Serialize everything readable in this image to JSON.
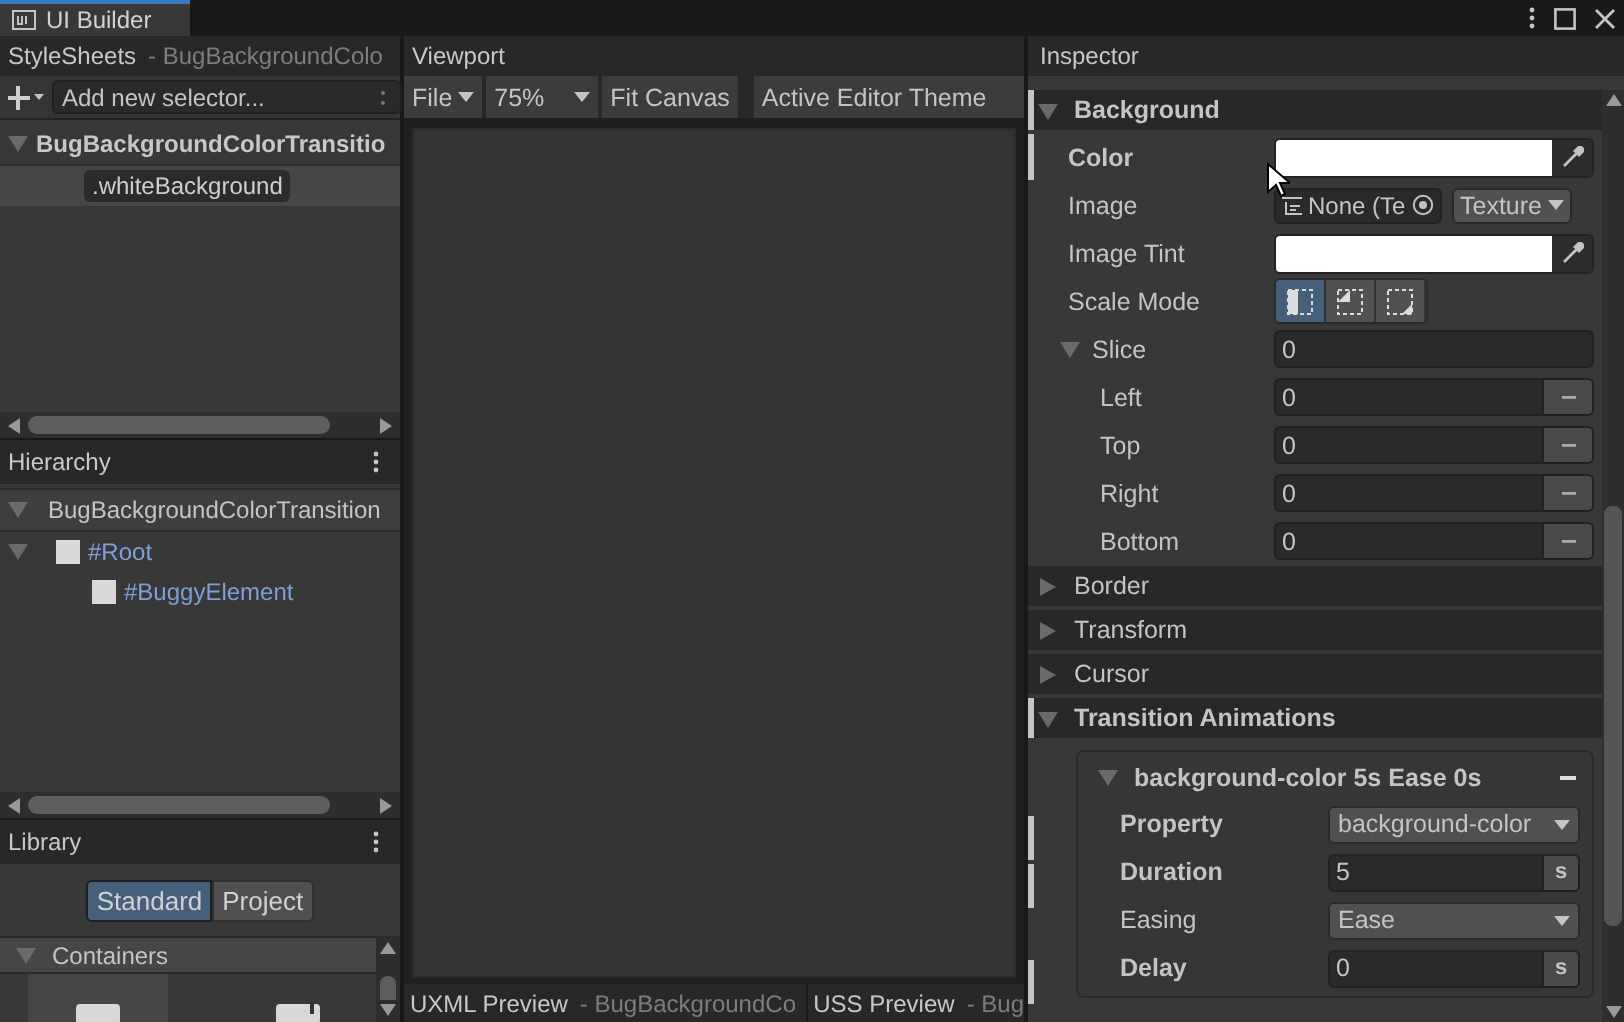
{
  "window_tab": {
    "title": "UI Builder"
  },
  "stylesheets": {
    "title": "StyleSheets",
    "subtitle": "- BugBackgroundColo",
    "selector_placeholder": "Add new selector...",
    "tree": [
      {
        "label": "BugBackgroundColorTransitio",
        "expanded": true,
        "children": [
          {
            "label": ".whiteBackground",
            "selected": true
          }
        ]
      }
    ]
  },
  "hierarchy": {
    "title": "Hierarchy",
    "tree": [
      {
        "label": "BugBackgroundColorTransition",
        "expanded": true,
        "children": [
          {
            "label": "#Root",
            "expanded": true,
            "children": [
              {
                "label": "#BuggyElement"
              }
            ]
          }
        ]
      }
    ]
  },
  "library": {
    "title": "Library",
    "tabs": [
      {
        "label": "Standard",
        "selected": true
      },
      {
        "label": "Project",
        "selected": false
      }
    ],
    "section": {
      "label": "Containers",
      "expanded": true
    }
  },
  "viewport": {
    "title": "Viewport",
    "toolbar": [
      {
        "kind": "menu",
        "label": "File"
      },
      {
        "kind": "dropdown",
        "label": "75%"
      },
      {
        "kind": "button",
        "label": "Fit Canvas"
      },
      {
        "kind": "button",
        "label": "Active Editor Theme"
      }
    ]
  },
  "previews": [
    {
      "title": "UXML Preview",
      "subtitle": "- BugBackgroundCo"
    },
    {
      "title": "USS Preview",
      "subtitle": "- Bug"
    }
  ],
  "inspector": {
    "title": "Inspector",
    "sections": [
      {
        "label": "Background",
        "expanded": true,
        "overridden": true,
        "rows": [
          {
            "kind": "color",
            "label": "Color",
            "overridden": true,
            "color": "#ffffff"
          },
          {
            "kind": "object",
            "label": "Image",
            "overridden": false,
            "value": "None (Te",
            "type": "Texture"
          },
          {
            "kind": "color",
            "label": "Image Tint",
            "overridden": false,
            "color": "#ffffff"
          },
          {
            "kind": "segments",
            "label": "Scale Mode",
            "overridden": false,
            "options": [
              {
                "selected": true
              },
              {
                "selected": false
              },
              {
                "selected": false
              }
            ]
          },
          {
            "kind": "foldout",
            "label": "Slice",
            "overridden": false,
            "expanded": true,
            "value": "0",
            "children": [
              {
                "label": "Left",
                "value": "0"
              },
              {
                "label": "Top",
                "value": "0"
              },
              {
                "label": "Right",
                "value": "0"
              },
              {
                "label": "Bottom",
                "value": "0"
              }
            ]
          }
        ]
      },
      {
        "label": "Border",
        "expanded": false,
        "overridden": false
      },
      {
        "label": "Transform",
        "expanded": false,
        "overridden": false
      },
      {
        "label": "Cursor",
        "expanded": false,
        "overridden": false
      },
      {
        "label": "Transition Animations",
        "expanded": true,
        "overridden": true,
        "transitions": [
          {
            "title": "background-color 5s Ease 0s",
            "expanded": true,
            "fields": [
              {
                "kind": "dropdown",
                "label": "Property",
                "overridden": true,
                "value": "background-color"
              },
              {
                "kind": "number",
                "label": "Duration",
                "overridden": true,
                "value": "5",
                "unit": "s"
              },
              {
                "kind": "dropdown",
                "label": "Easing",
                "overridden": false,
                "value": "Ease"
              },
              {
                "kind": "number",
                "label": "Delay",
                "overridden": true,
                "value": "0",
                "unit": "s"
              }
            ]
          }
        ]
      }
    ]
  }
}
